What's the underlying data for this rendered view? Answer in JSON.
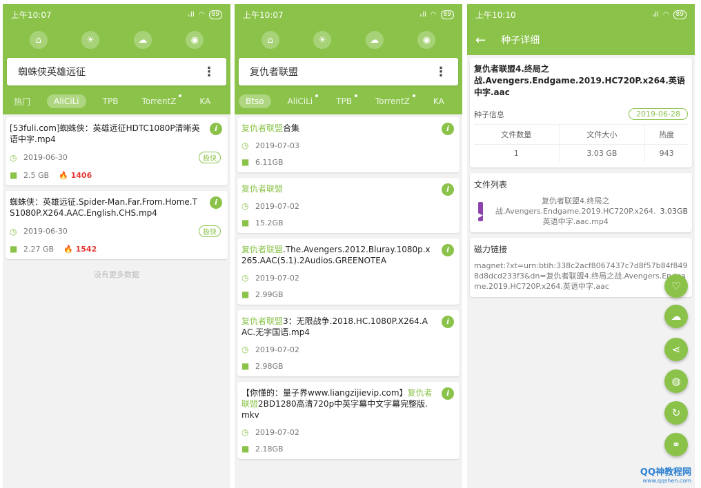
{
  "status": {
    "time1": "上午10:07",
    "time2": "上午10:07",
    "time3": "上午10:10",
    "signal": "ᵢᵢll",
    "battery": "89"
  },
  "icons": {
    "top": [
      "home-icon",
      "sun-icon",
      "weather-icon",
      "rss-icon"
    ],
    "info": "i",
    "more": "⋮",
    "menu": "☰",
    "back": "←"
  },
  "screen1": {
    "search_value": "蜘蛛侠英雄远征",
    "tabs": [
      "热门",
      "AliCiLi",
      "TPB",
      "TorrentZ",
      "KA"
    ],
    "results": [
      {
        "title": "[53fuli.com]蜘蛛侠：英雄远征HDTC1080P清晰英语中字.mp4",
        "date": "2019-06-30",
        "size": "2.5 GB",
        "heat": "1406",
        "badge": "极快"
      },
      {
        "title": "蜘蛛侠：英雄远征.Spider-Man.Far.From.Home.TS1080P.X264.AAC.English.CHS.mp4",
        "date": "2019-06-30",
        "size": "2.27 GB",
        "heat": "1542",
        "badge": "极快"
      }
    ],
    "no_more": "没有更多数据"
  },
  "screen2": {
    "search_value": "复仇者联盟",
    "tabs": [
      "Btso",
      "AliCiLi",
      "TPB",
      "TorrentZ",
      "KA"
    ],
    "results": [
      {
        "pre": "",
        "hl": "复仇者联盟",
        "post": "合集",
        "date": "2019-07-03",
        "size": "6.11GB"
      },
      {
        "pre": "",
        "hl": "复仇者联盟",
        "post": "",
        "date": "2019-07-02",
        "size": "15.2GB"
      },
      {
        "pre": "",
        "hl": "复仇者联盟",
        "post": ".The.Avengers.2012.Bluray.1080p.x265.AAC(5.1).2Audios.GREENOTEA",
        "date": "2019-07-02",
        "size": "2.99GB"
      },
      {
        "pre": "",
        "hl": "复仇者联盟",
        "post": "3：无限战争.2018.HC.1080P.X264.AAC.无字国语.mp4",
        "date": "2019-07-02",
        "size": "2.98GB"
      },
      {
        "pre": "【你懂的：量子界www.liangzijievip.com】",
        "hl": "复仇者联盟",
        "post": "2BD1280高清720p中英字幕中文字幕完整版.mkv",
        "date": "2019-07-02",
        "size": "2.18GB"
      }
    ]
  },
  "screen3": {
    "header_title": "种子详细",
    "title": "复仇者联盟4.终局之战.Avengers.Endgame.2019.HC720P.x264.英语中字.aac",
    "seed_info_label": "种子信息",
    "date": "2019-06-28",
    "stats_headers": [
      "文件数量",
      "文件大小",
      "热度"
    ],
    "stats_values": [
      "1",
      "3.03 GB",
      "943"
    ],
    "file_list_label": "文件列表",
    "file_name": "复仇者联盟4.终局之战.Avengers.Endgame.2019.HC720P.x264.英语中字.aac.mp4",
    "file_size": "3.03GB",
    "magnet_label": "磁力链接",
    "magnet": "magnet:?xt=urn:btih:338c2acf8067437c7d8f57b84f8498d8dcd233f3&dn=复仇者联盟4.终局之战.Avengers.Endgame.2019.HC720P.x264.英语中字.aac",
    "fabs": [
      "favorite-icon",
      "cloud-download-icon",
      "share-icon",
      "browser-icon",
      "refresh-icon",
      "link-icon"
    ]
  },
  "watermark": {
    "brand": "QQ神教程网",
    "url": "www.qqshen.com"
  },
  "colors": {
    "accent": "#8bc34a",
    "heat": "#e53935",
    "file_icon": "#8e44ad"
  }
}
